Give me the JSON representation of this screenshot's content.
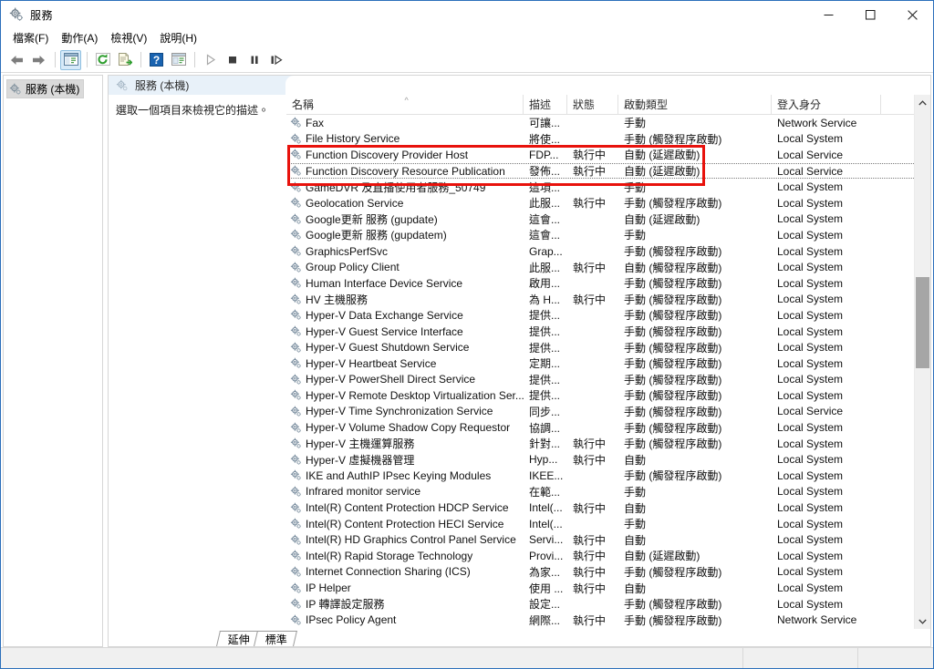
{
  "window": {
    "title": "服務",
    "app_icon": "services-gear-icon",
    "controls": {
      "minimize": "minimize-icon",
      "maximize": "maximize-icon",
      "close": "close-icon"
    }
  },
  "menubar": [
    {
      "label": "檔案(F)",
      "accel": "F",
      "name": "menu-file"
    },
    {
      "label": "動作(A)",
      "accel": "A",
      "name": "menu-action"
    },
    {
      "label": "檢視(V)",
      "accel": "V",
      "name": "menu-view"
    },
    {
      "label": "說明(H)",
      "accel": "H",
      "name": "menu-help"
    }
  ],
  "toolbar": [
    {
      "name": "back-button",
      "icon": "arrow-left-icon",
      "state": "normal"
    },
    {
      "name": "forward-button",
      "icon": "arrow-right-icon",
      "state": "normal"
    },
    {
      "type": "separator"
    },
    {
      "name": "show-hide-tree-button",
      "icon": "console-tree-icon",
      "state": "active"
    },
    {
      "type": "separator"
    },
    {
      "name": "refresh-button",
      "icon": "refresh-icon",
      "state": "normal"
    },
    {
      "name": "export-list-button",
      "icon": "export-list-icon",
      "state": "normal"
    },
    {
      "type": "separator"
    },
    {
      "name": "help-button",
      "icon": "help-question-icon",
      "state": "normal"
    },
    {
      "name": "properties-button",
      "icon": "properties-icon",
      "state": "normal"
    },
    {
      "type": "separator"
    },
    {
      "name": "start-service-button",
      "icon": "play-icon",
      "state": "disabled"
    },
    {
      "name": "stop-service-button",
      "icon": "stop-icon",
      "state": "normal"
    },
    {
      "name": "pause-service-button",
      "icon": "pause-icon",
      "state": "normal"
    },
    {
      "name": "restart-service-button",
      "icon": "restart-icon",
      "state": "normal"
    }
  ],
  "tree": {
    "root_label": "服務 (本機)",
    "root_icon": "services-gear-icon"
  },
  "pane": {
    "header_label": "服務 (本機)",
    "header_icon": "services-gear-icon",
    "description_hint": "選取一個項目來檢視它的描述。"
  },
  "columns": [
    {
      "key": "name",
      "label": "名稱",
      "sorted": "asc"
    },
    {
      "key": "desc",
      "label": "描述"
    },
    {
      "key": "state",
      "label": "狀態"
    },
    {
      "key": "start",
      "label": "啟動類型"
    },
    {
      "key": "logon",
      "label": "登入身分"
    }
  ],
  "rows": [
    {
      "name": "Fax",
      "desc": "可讓...",
      "state": "",
      "start": "手動",
      "logon": "Network Service"
    },
    {
      "name": "File History Service",
      "desc": "將使...",
      "state": "",
      "start": "手動 (觸發程序啟動)",
      "logon": "Local System"
    },
    {
      "name": "Function Discovery Provider Host",
      "desc": "FDP...",
      "state": "執行中",
      "start": "自動 (延遲啟動)",
      "logon": "Local Service",
      "highlighted": true
    },
    {
      "name": "Function Discovery Resource Publication",
      "desc": "發佈...",
      "state": "執行中",
      "start": "自動 (延遲啟動)",
      "logon": "Local Service",
      "highlighted": true,
      "selected": true
    },
    {
      "name": "GameDVR 及直播使用者服務_50749",
      "desc": "這項...",
      "state": "",
      "start": "手動",
      "logon": "Local System"
    },
    {
      "name": "Geolocation Service",
      "desc": "此服...",
      "state": "執行中",
      "start": "手動 (觸發程序啟動)",
      "logon": "Local System"
    },
    {
      "name": "Google更新 服務 (gupdate)",
      "desc": "這會...",
      "state": "",
      "start": "自動 (延遲啟動)",
      "logon": "Local System"
    },
    {
      "name": "Google更新 服務 (gupdatem)",
      "desc": "這會...",
      "state": "",
      "start": "手動",
      "logon": "Local System"
    },
    {
      "name": "GraphicsPerfSvc",
      "desc": "Grap...",
      "state": "",
      "start": "手動 (觸發程序啟動)",
      "logon": "Local System"
    },
    {
      "name": "Group Policy Client",
      "desc": "此服...",
      "state": "執行中",
      "start": "自動 (觸發程序啟動)",
      "logon": "Local System"
    },
    {
      "name": "Human Interface Device Service",
      "desc": "啟用...",
      "state": "",
      "start": "手動 (觸發程序啟動)",
      "logon": "Local System"
    },
    {
      "name": "HV 主機服務",
      "desc": "為 H...",
      "state": "執行中",
      "start": "手動 (觸發程序啟動)",
      "logon": "Local System"
    },
    {
      "name": "Hyper-V Data Exchange Service",
      "desc": "提供...",
      "state": "",
      "start": "手動 (觸發程序啟動)",
      "logon": "Local System"
    },
    {
      "name": "Hyper-V Guest Service Interface",
      "desc": "提供...",
      "state": "",
      "start": "手動 (觸發程序啟動)",
      "logon": "Local System"
    },
    {
      "name": "Hyper-V Guest Shutdown Service",
      "desc": "提供...",
      "state": "",
      "start": "手動 (觸發程序啟動)",
      "logon": "Local System"
    },
    {
      "name": "Hyper-V Heartbeat Service",
      "desc": "定期...",
      "state": "",
      "start": "手動 (觸發程序啟動)",
      "logon": "Local System"
    },
    {
      "name": "Hyper-V PowerShell Direct Service",
      "desc": "提供...",
      "state": "",
      "start": "手動 (觸發程序啟動)",
      "logon": "Local System"
    },
    {
      "name": "Hyper-V Remote Desktop Virtualization Ser...",
      "desc": "提供...",
      "state": "",
      "start": "手動 (觸發程序啟動)",
      "logon": "Local System"
    },
    {
      "name": "Hyper-V Time Synchronization Service",
      "desc": "同步...",
      "state": "",
      "start": "手動 (觸發程序啟動)",
      "logon": "Local Service"
    },
    {
      "name": "Hyper-V Volume Shadow Copy Requestor",
      "desc": "協調...",
      "state": "",
      "start": "手動 (觸發程序啟動)",
      "logon": "Local System"
    },
    {
      "name": "Hyper-V 主機運算服務",
      "desc": "針對...",
      "state": "執行中",
      "start": "手動 (觸發程序啟動)",
      "logon": "Local System"
    },
    {
      "name": "Hyper-V 虛擬機器管理",
      "desc": "Hyp...",
      "state": "執行中",
      "start": "自動",
      "logon": "Local System"
    },
    {
      "name": "IKE and AuthIP IPsec Keying Modules",
      "desc": "IKEE...",
      "state": "",
      "start": "手動 (觸發程序啟動)",
      "logon": "Local System"
    },
    {
      "name": "Infrared monitor service",
      "desc": "在範...",
      "state": "",
      "start": "手動",
      "logon": "Local System"
    },
    {
      "name": "Intel(R) Content Protection HDCP Service",
      "desc": "Intel(...",
      "state": "執行中",
      "start": "自動",
      "logon": "Local System"
    },
    {
      "name": "Intel(R) Content Protection HECI Service",
      "desc": "Intel(...",
      "state": "",
      "start": "手動",
      "logon": "Local System"
    },
    {
      "name": "Intel(R) HD Graphics Control Panel Service",
      "desc": "Servi...",
      "state": "執行中",
      "start": "自動",
      "logon": "Local System"
    },
    {
      "name": "Intel(R) Rapid Storage Technology",
      "desc": "Provi...",
      "state": "執行中",
      "start": "自動 (延遲啟動)",
      "logon": "Local System"
    },
    {
      "name": "Internet Connection Sharing (ICS)",
      "desc": "為家...",
      "state": "執行中",
      "start": "手動 (觸發程序啟動)",
      "logon": "Local System"
    },
    {
      "name": "IP Helper",
      "desc": "使用 ...",
      "state": "執行中",
      "start": "自動",
      "logon": "Local System"
    },
    {
      "name": "IP 轉譯設定服務",
      "desc": "設定...",
      "state": "",
      "start": "手動 (觸發程序啟動)",
      "logon": "Local System"
    },
    {
      "name": "IPsec Policy Agent",
      "desc": "網際...",
      "state": "執行中",
      "start": "手動 (觸發程序啟動)",
      "logon": "Network Service"
    }
  ],
  "tabs": [
    {
      "label": "延伸",
      "name": "tab-extended",
      "active": false
    },
    {
      "label": "標準",
      "name": "tab-standard",
      "active": true
    }
  ],
  "annotation": {
    "color": "#e8120c",
    "target_rows": [
      "Function Discovery Provider Host",
      "Function Discovery Resource Publication"
    ]
  },
  "scrollbar": {
    "up_arrow": "chevron-up-icon",
    "down_arrow": "chevron-down-icon"
  }
}
